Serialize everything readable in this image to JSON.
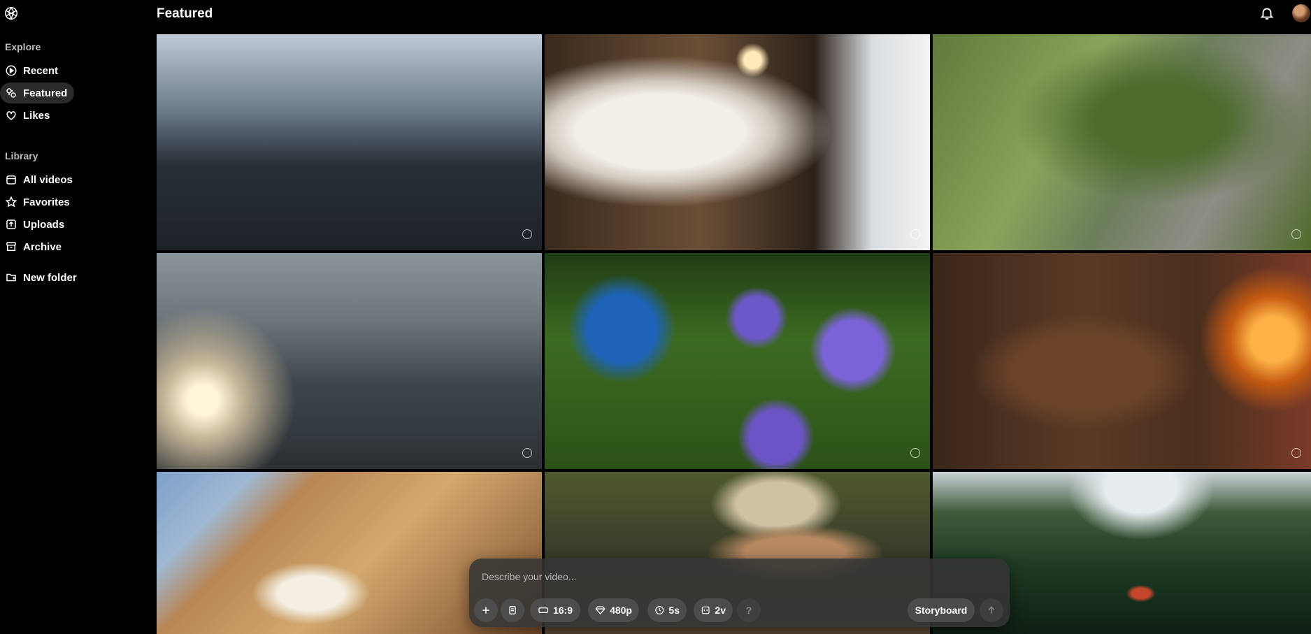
{
  "app": {
    "page_title": "Featured"
  },
  "sidebar": {
    "explore_title": "Explore",
    "explore_items": [
      {
        "label": "Recent",
        "icon": "play-circle-icon"
      },
      {
        "label": "Featured",
        "icon": "featured-icon",
        "active": true
      },
      {
        "label": "Likes",
        "icon": "heart-icon"
      }
    ],
    "library_title": "Library",
    "library_items": [
      {
        "label": "All videos",
        "icon": "video-library-icon"
      },
      {
        "label": "Favorites",
        "icon": "star-icon"
      },
      {
        "label": "Uploads",
        "icon": "upload-icon"
      },
      {
        "label": "Archive",
        "icon": "archive-icon"
      }
    ],
    "new_folder_label": "New folder"
  },
  "header": {
    "bell_icon": "bell-icon",
    "avatar": "user-avatar"
  },
  "grid": {
    "tiles": [
      "couple-train-station",
      "lamb-window",
      "elderly-woman-peach-path",
      "lake-sunlight-trees",
      "butterfly-purple-flowers",
      "bear-knitting-fireplace",
      "unicorn-arches",
      "miner-with-headlamp",
      "lake-cabin-forest"
    ]
  },
  "composer": {
    "placeholder": "Describe your video...",
    "aspect_ratio": "16:9",
    "resolution": "480p",
    "duration": "5s",
    "variations": "2v",
    "help": "?",
    "storyboard_label": "Storyboard"
  },
  "colors": {
    "background": "#000000",
    "active_nav": "#2a2a2a",
    "composer_bg": "#343434"
  }
}
